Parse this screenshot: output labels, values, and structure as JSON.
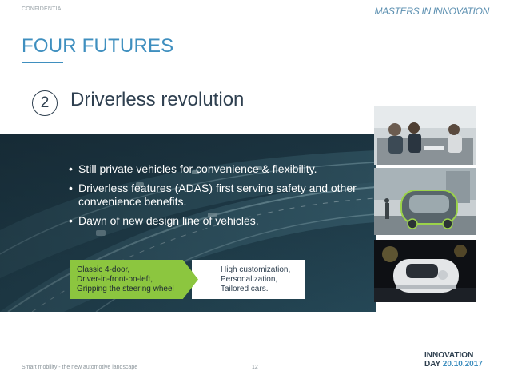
{
  "header": {
    "confidential": "CONFIDENTIAL",
    "brand": "MASTERS IN INNOVATION"
  },
  "slide": {
    "title": "FOUR FUTURES",
    "section_number": "2",
    "subtitle": "Driverless revolution",
    "bullets": [
      "Still private vehicles for convenience & flexibility.",
      "Driverless features (ADAS) first serving safety and other convenience benefits.",
      "Dawn of new design line of vehicles."
    ],
    "evolution": {
      "from": [
        "Classic 4-door,",
        "Driver-in-front-on-left,",
        "Gripping the steering wheel"
      ],
      "to": [
        "High customization,",
        "Personalization,",
        "Tailored cars."
      ]
    }
  },
  "footer": {
    "text": "Smart mobility - the new automotive landscape",
    "page": "12",
    "logo_line1": "INNOVATION",
    "logo_line2_prefix": "DAY",
    "logo_date": "20.10.2017"
  },
  "colors": {
    "accent_blue": "#3f8fbf",
    "dark_text": "#2f4050",
    "green": "#8cc63f"
  },
  "icons": [
    "highway-image",
    "interior-photo",
    "pod-street-photo",
    "pod-night-photo"
  ]
}
